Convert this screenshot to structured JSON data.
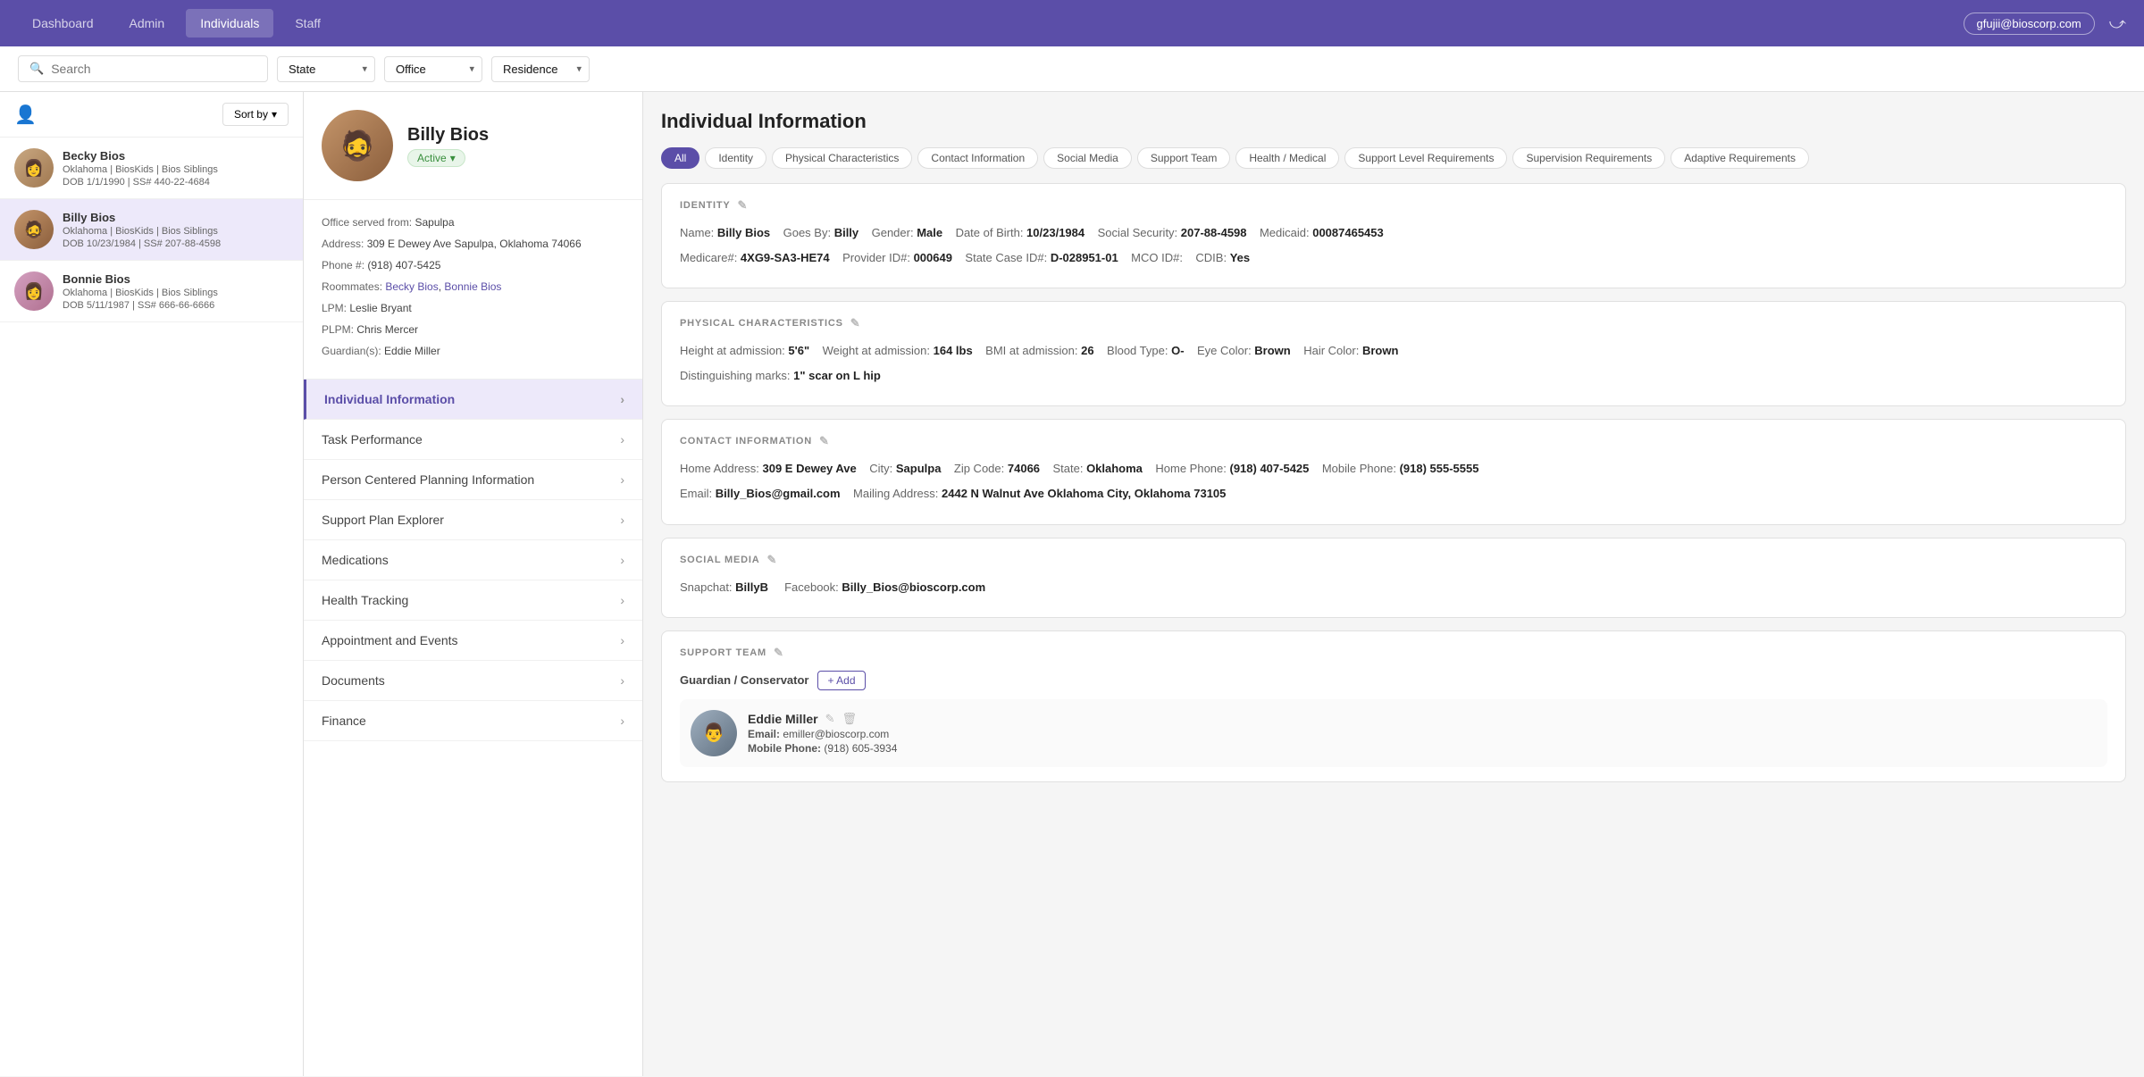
{
  "nav": {
    "tabs": [
      {
        "label": "Dashboard",
        "active": false
      },
      {
        "label": "Admin",
        "active": false
      },
      {
        "label": "Individuals",
        "active": true
      },
      {
        "label": "Staff",
        "active": false
      }
    ],
    "user": "gfujii@bioscorp.com"
  },
  "filters": {
    "search_placeholder": "Search",
    "state_label": "State",
    "office_label": "Office",
    "residence_label": "Residence"
  },
  "sidebar": {
    "sort_label": "Sort by",
    "persons": [
      {
        "name": "Becky Bios",
        "detail1": "Oklahoma | BiosKids | Bios Siblings",
        "detail2": "DOB 1/1/1990 | SS# 440-22-4684"
      },
      {
        "name": "Billy Bios",
        "detail1": "Oklahoma | BiosKids | Bios Siblings",
        "detail2": "DOB 10/23/1984 | SS# 207-88-4598",
        "selected": true
      },
      {
        "name": "Bonnie Bios",
        "detail1": "Oklahoma | BiosKids | Bios Siblings",
        "detail2": "DOB 5/11/1987 | SS# 666-66-6666"
      }
    ]
  },
  "profile": {
    "name": "Billy Bios",
    "status": "Active",
    "office_served": "Sapulpa",
    "address": "309 E Dewey Ave Sapulpa, Oklahoma 74066",
    "phone": "(918) 407-5425",
    "roommates": [
      "Becky Bios",
      "Bonnie Bios"
    ],
    "lpm": "Leslie Bryant",
    "plpm": "Chris Mercer",
    "guardian": "Eddie Miller"
  },
  "menu_items": [
    {
      "label": "Individual Information",
      "active": true
    },
    {
      "label": "Task Performance",
      "active": false
    },
    {
      "label": "Person Centered Planning Information",
      "active": false
    },
    {
      "label": "Support Plan Explorer",
      "active": false
    },
    {
      "label": "Medications",
      "active": false
    },
    {
      "label": "Health Tracking",
      "active": false
    },
    {
      "label": "Appointment and Events",
      "active": false
    },
    {
      "label": "Documents",
      "active": false
    },
    {
      "label": "Finance",
      "active": false
    }
  ],
  "info_panel": {
    "title": "Individual Information",
    "tabs": [
      {
        "label": "All",
        "active": true
      },
      {
        "label": "Identity",
        "active": false
      },
      {
        "label": "Physical Characteristics",
        "active": false
      },
      {
        "label": "Contact Information",
        "active": false
      },
      {
        "label": "Social Media",
        "active": false
      },
      {
        "label": "Support Team",
        "active": false
      },
      {
        "label": "Health / Medical",
        "active": false
      },
      {
        "label": "Support Level Requirements",
        "active": false
      },
      {
        "label": "Supervision Requirements",
        "active": false
      },
      {
        "label": "Adaptive Requirements",
        "active": false
      }
    ],
    "identity": {
      "header": "IDENTITY",
      "name": "Billy Bios",
      "goes_by": "Billy",
      "gender": "Male",
      "dob": "10/23/1984",
      "social_security": "207-88-4598",
      "medicaid": "00087465453",
      "medicare": "4XG9-SA3-HE74",
      "provider_id": "000649",
      "state_case_id": "D-028951-01",
      "mco_id": "",
      "cdib": "Yes"
    },
    "physical": {
      "header": "PHYSICAL CHARACTERISTICS",
      "height": "5'6\"",
      "weight": "164 lbs",
      "bmi": "26",
      "blood_type": "O-",
      "eye_color": "Brown",
      "hair_color": "Brown",
      "distinguishing_marks": "1\" scar on L hip"
    },
    "contact": {
      "header": "CONTACT INFORMATION",
      "home_address": "309 E Dewey Ave",
      "city": "Sapulpa",
      "zip": "74066",
      "state": "Oklahoma",
      "home_phone": "(918) 407-5425",
      "mobile_phone": "(918) 555-5555",
      "email": "Billy_Bios@gmail.com",
      "mailing_address": "2442 N Walnut Ave Oklahoma City, Oklahoma 73105"
    },
    "social_media": {
      "header": "SOCIAL MEDIA",
      "snapchat": "BillyB",
      "facebook": "Billy_Bios@bioscorp.com"
    },
    "support_team": {
      "header": "SUPPORT TEAM",
      "section": "Guardian / Conservator",
      "add_label": "+ Add",
      "member": {
        "name": "Eddie Miller",
        "email": "emiller@bioscorp.com",
        "mobile": "(918) 605-3934"
      }
    }
  }
}
